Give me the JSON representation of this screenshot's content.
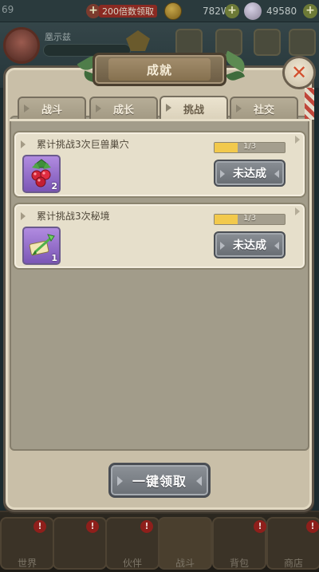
{
  "hud": {
    "level": "69",
    "red_label": "200倍数领取",
    "gold_amount": "782W",
    "pearl_amount": "49580"
  },
  "player": {
    "name": "凰示兹"
  },
  "panel": {
    "title": "成就",
    "close_symbol": "✕"
  },
  "tabs": [
    {
      "label": "战斗",
      "active": false
    },
    {
      "label": "成长",
      "active": false
    },
    {
      "label": "挑战",
      "active": true
    },
    {
      "label": "社交",
      "active": false
    }
  ],
  "tasks": [
    {
      "title": "累计挑战3次巨兽巢穴",
      "reward_icon": "red-berries-icon",
      "reward_count": "2",
      "progress_text": "1/3",
      "progress_fraction": 0.333,
      "status_label": "未达成"
    },
    {
      "title": "累计挑战3次秘境",
      "reward_icon": "green-arrow-scroll-icon",
      "reward_count": "1",
      "progress_text": "1/3",
      "progress_fraction": 0.333,
      "status_label": "未达成"
    }
  ],
  "claim_all_label": "一键领取",
  "bottom_nav": {
    "labels": [
      "世界",
      "",
      "伙伴",
      "战斗",
      "背包",
      "商店"
    ],
    "badge_symbol": "!"
  },
  "colors": {
    "progress_fill": "#f2c94c",
    "close_x": "#d3502f",
    "item_slot_purple": "#8f66c8"
  }
}
